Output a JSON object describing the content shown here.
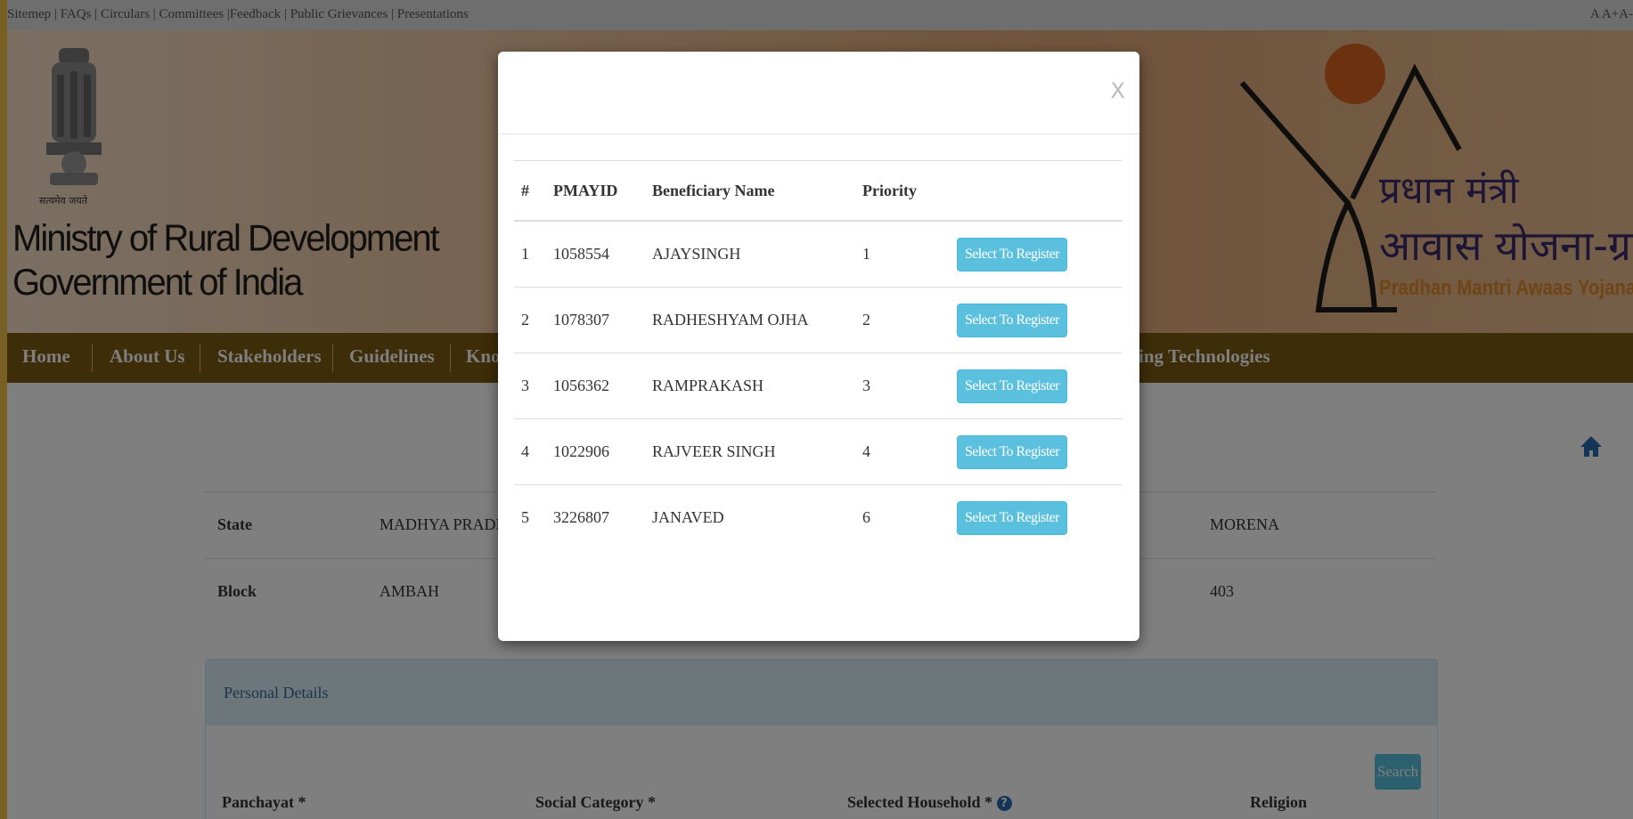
{
  "top_links": {
    "items": [
      "Sitemep",
      "FAQs",
      "Circulars",
      "Committees",
      "Feedback",
      "Public Grievances",
      "Presentations"
    ],
    "font_size": [
      "A",
      "A+",
      "A-"
    ]
  },
  "header": {
    "emblem_motto": "सत्यमेव जयते",
    "ministry_line1": "Ministry of Rural Development",
    "ministry_line2": "Government of India",
    "logo_hindi_line1": "प्रधान मंत्री",
    "logo_hindi_line2": "आवास योजना-ग्रामीण",
    "logo_english": "Pradhan Mantri Awaas Yojana-Gramin"
  },
  "nav": {
    "items": [
      "Home",
      "About Us",
      "Stakeholders",
      "Guidelines",
      "Know"
    ],
    "tail": "ing Technologies"
  },
  "info": {
    "row1": {
      "label": "State",
      "value": "MADHYA PRADESH",
      "right_value": "MORENA"
    },
    "row2": {
      "label": "Block",
      "value": "AMBAH",
      "right_value": "403"
    }
  },
  "personal_details": {
    "heading": "Personal Details",
    "search_label": "Search",
    "fields": [
      "Panchayat *",
      "Social Category *",
      "Selected Household *",
      "Religion"
    ]
  },
  "modal": {
    "close_label": "X",
    "columns": [
      "#",
      "PMAYID",
      "Beneficiary Name",
      "Priority",
      ""
    ],
    "button_label": "Select To Register",
    "rows": [
      {
        "num": "1",
        "pmayid": "1058554",
        "name": "AJAYSINGH",
        "priority": "1"
      },
      {
        "num": "2",
        "pmayid": "1078307",
        "name": "RADHESHYAM OJHA",
        "priority": "2"
      },
      {
        "num": "3",
        "pmayid": "1056362",
        "name": "RAMPRAKASH",
        "priority": "3"
      },
      {
        "num": "4",
        "pmayid": "1022906",
        "name": "RAJVEER SINGH",
        "priority": "4"
      },
      {
        "num": "5",
        "pmayid": "3226807",
        "name": "JANAVED",
        "priority": "6"
      }
    ]
  },
  "colors": {
    "accent_button": "#5bc0de",
    "nav_bg": "#7a5a10",
    "border_frame": "#f0c14b"
  }
}
